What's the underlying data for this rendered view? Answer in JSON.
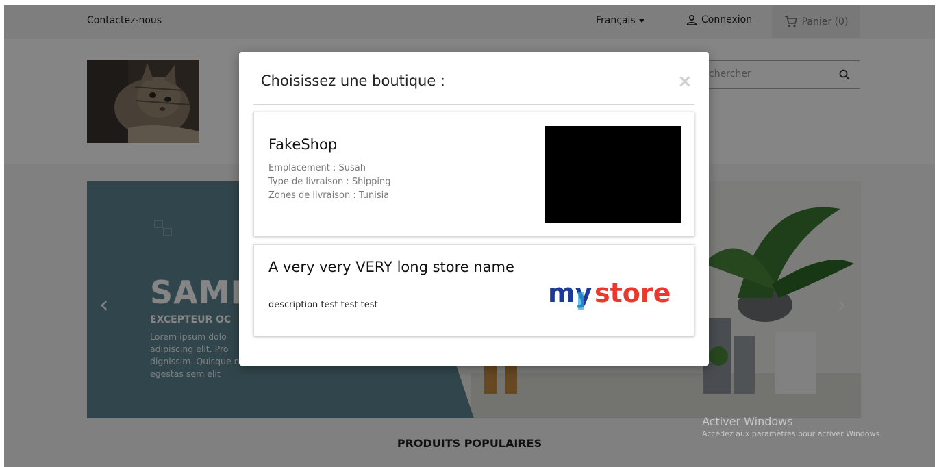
{
  "topbar": {
    "contact": "Contactez-nous",
    "language": "Français",
    "login": "Connexion",
    "cart": "Panier (0)"
  },
  "header": {
    "search_placeholder": "Rechercher",
    "search_visible_text": "chercher"
  },
  "slider": {
    "title": "SAMP",
    "subtitle": "EXCEPTEUR OC",
    "text_lines": [
      "Lorem ipsum dolo",
      "adipiscing elit. Pro",
      "dignissim. Quisque non tempor leo. Maecenas",
      "egestas sem elit"
    ],
    "prev": "‹",
    "next": "›"
  },
  "section": {
    "popular_title": "PRODUITS POPULAIRES"
  },
  "modal": {
    "title": "Choisissez une boutique :",
    "close": "×",
    "stores": [
      {
        "name": "FakeShop",
        "location": "Emplacement : Susah",
        "delivery_type": "Type de livraison : Shipping",
        "delivery_zones": "Zones de livraison : Tunisia"
      },
      {
        "name": "A very very VERY long store name",
        "description": "description test test test",
        "logo_text": "my store"
      }
    ]
  },
  "watermark": {
    "line1": "Activer Windows",
    "line2": "Accédez aux paramètres pour activer Windows."
  },
  "colors": {
    "slider_teal": "#5f8792",
    "overlay": "rgba(0,0,0,0.48)",
    "logo_blue": "#1b3a9a",
    "logo_red": "#e8392e"
  },
  "icons": [
    "caret-down-icon",
    "user-icon",
    "cart-icon",
    "search-icon",
    "slide-squares-icon",
    "close-icon"
  ]
}
